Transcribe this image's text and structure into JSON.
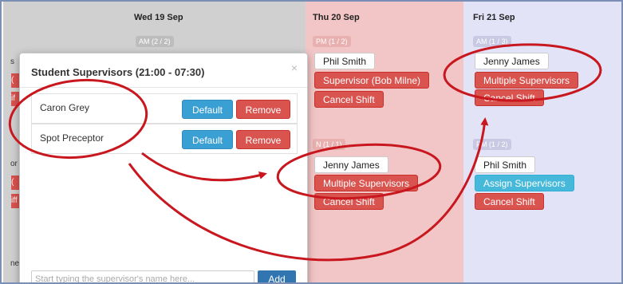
{
  "days": {
    "wed": {
      "header": "Wed 19 Sep",
      "slot": "AM (2 / 2)"
    },
    "thu": {
      "header": "Thu 20 Sep",
      "slot_top": "PM (1 / 2)",
      "slot_bottom": "N (1 / 1)"
    },
    "fri": {
      "header": "Fri 21 Sep",
      "slot_top": "AM (1 / 3)",
      "slot_bottom": "PM (1 / 2)"
    }
  },
  "left_stubs": [
    "s",
    "(",
    "if",
    "or",
    "(",
    "iff",
    "ne"
  ],
  "thu_shifts": {
    "top": {
      "name": "Phil Smith",
      "action": "Supervisor (Bob Milne)",
      "cancel": "Cancel Shift"
    },
    "bottom": {
      "name": "Jenny James",
      "action": "Multiple Supervisors",
      "cancel": "Cancel Shift"
    }
  },
  "fri_shifts": {
    "top": {
      "name": "Jenny James",
      "action": "Multiple Supervisors",
      "cancel": "Cancel Shift"
    },
    "bottom": {
      "name": "Phil Smith",
      "action": "Assign Supervisors",
      "cancel": "Cancel Shift"
    }
  },
  "modal": {
    "title": "Student Supervisors (21:00 - 07:30)",
    "close": "×",
    "supervisors": [
      {
        "name": "Caron Grey",
        "default_label": "Default",
        "remove_label": "Remove"
      },
      {
        "name": "Spot Preceptor",
        "default_label": "Default",
        "remove_label": "Remove"
      }
    ],
    "search": {
      "placeholder": "Start typing the supervisor's name here..."
    },
    "add_label": "Add"
  },
  "colors": {
    "annotation_red": "#c8171e",
    "danger": "#d9534f",
    "info": "#46b8da",
    "primary": "#3276b1",
    "thu_bg": "#f2c6c6",
    "fri_bg": "#e3e3f8"
  }
}
